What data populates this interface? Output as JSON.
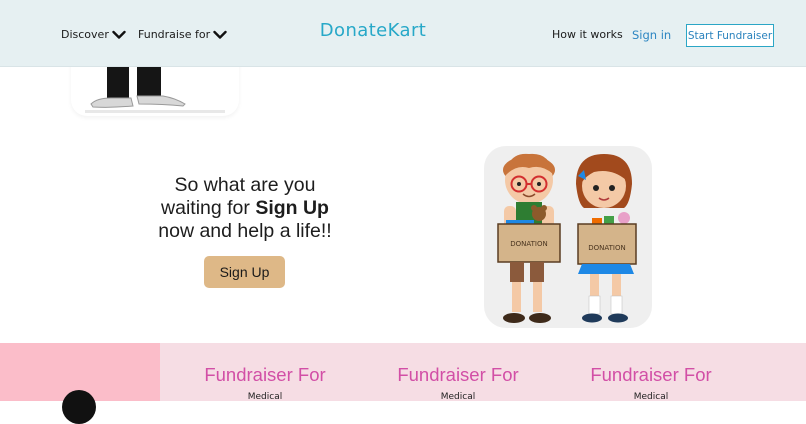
{
  "nav": {
    "discover": "Discover",
    "fundraise_for": "Fundraise for",
    "brand": "DonateKart",
    "how_it_works": "How it works",
    "sign_in": "Sign in",
    "start_fundraiser": "Start Fundraiser"
  },
  "signup": {
    "line1": "So what are you",
    "line2_prefix": "waiting for ",
    "line2_bold": "Sign Up",
    "line3": "now and help a life!!",
    "button": "Sign Up"
  },
  "illustration": {
    "box_label_left": "DONATION",
    "box_label_right": "DONATION"
  },
  "fundraisers": [
    {
      "title": "Fundraiser For",
      "sub": "Medical"
    },
    {
      "title": "Fundraiser For",
      "sub": "Medical"
    },
    {
      "title": "Fundraiser For",
      "sub": "Medical"
    }
  ],
  "colors": {
    "brand": "#27a8c8",
    "nav_bg": "#e6f0f2",
    "signup_button": "#deb887",
    "fundraiser_title": "#d24fa6",
    "band_left": "#fbbdc9",
    "band_main": "#f6dde4"
  },
  "icons": [
    "chevron-down-icon",
    "chevron-down-icon"
  ]
}
